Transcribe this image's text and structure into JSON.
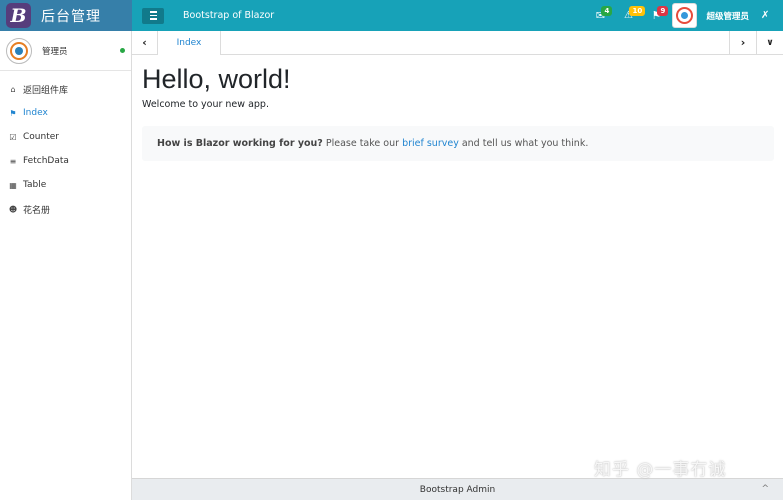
{
  "brand": {
    "logo_letter": "B",
    "title": "后台管理"
  },
  "navbar": {
    "title": "Bootstrap of Blazor",
    "icons": [
      {
        "name": "envelope-icon",
        "glyph": "✉",
        "badge": "4",
        "badge_color": "#28a745"
      },
      {
        "name": "bell-icon",
        "glyph": "🔔",
        "badge": "10",
        "badge_color": "#ffc107"
      },
      {
        "name": "flag-icon",
        "glyph": "⚑",
        "badge": "9",
        "badge_color": "#dc3545"
      }
    ],
    "user_name": "超级管理员",
    "share_glyph": "⋞"
  },
  "sidebar": {
    "username": "管理员",
    "online_color": "#28a745",
    "items": [
      {
        "label": "返回组件库",
        "icon": "home-icon",
        "glyph": "⌂",
        "active": false
      },
      {
        "label": "Index",
        "icon": "flag-icon",
        "glyph": "⚑",
        "active": true
      },
      {
        "label": "Counter",
        "icon": "check-square-icon",
        "glyph": "☑",
        "active": false
      },
      {
        "label": "FetchData",
        "icon": "database-icon",
        "glyph": "≡",
        "active": false
      },
      {
        "label": "Table",
        "icon": "table-icon",
        "glyph": "▦",
        "active": false
      },
      {
        "label": "花名册",
        "icon": "users-icon",
        "glyph": "👥",
        "active": false
      }
    ]
  },
  "tabs": {
    "left_arrow": "‹",
    "items": [
      {
        "label": "Index",
        "active": true
      }
    ],
    "right_arrow": "›",
    "dropdown": "⌄"
  },
  "main": {
    "heading": "Hello, world!",
    "welcome": "Welcome to your new app.",
    "alert": {
      "strong": "How is Blazor working for you?",
      "before_link": "Please take our",
      "link": "brief survey",
      "after_link": "and tell us what you think."
    }
  },
  "footer": {
    "text": "Bootstrap Admin",
    "up_arrow": "^"
  },
  "watermark": "知乎 @一事冇诚",
  "colors": {
    "brand_bg": "#367fa9",
    "navbar_bg": "#17a2b8",
    "accent": "#2185d0",
    "footer_bg": "#e9ecef"
  }
}
